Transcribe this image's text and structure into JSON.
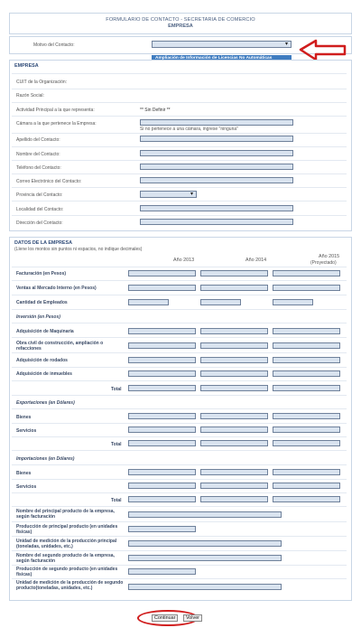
{
  "header": {
    "line1": "FORMULARIO DE CONTACTO - SECRETARIA DE COMERCIO",
    "line2": "EMPRESA"
  },
  "motivo": {
    "label": "Motivo del Contacto:",
    "selected": "",
    "option": "Ampliación de Información de Licencias No Automáticas"
  },
  "empresa": {
    "title": "EMPRESA",
    "cuit": "CUIT de la Organización:",
    "razon": "Razón Social:",
    "actividad": "Actividad Principal a la que representa:",
    "actividad_value": "** Sin Definir **",
    "camara": "Cámara a la que pertenece la Empresa:",
    "camara_hint": "Si no pertenece a una cámara, ingrese \"ninguna\"",
    "apellido": "Apellido del Contacto:",
    "nombre": "Nombre del Contacto:",
    "telefono": "Teléfono del Contacto:",
    "correo": "Correo Electrónico del Contacto:",
    "provincia": "Provincia del Contacto:",
    "localidad": "Localidad del Contacto:",
    "direccion": "Dirección del Contacto:"
  },
  "datos": {
    "title": "DATOS DE LA EMPRESA",
    "subtitle": "(Llene los montos sin puntos ni espacios, no indique decimales)",
    "year1": "Año 2013",
    "year2": "Año 2014",
    "year3": "Año 2015",
    "year3_note": "(Proyectado)",
    "facturacion": "Facturación (en Pesos)",
    "ventas": "Ventas al Mercado Interno (en Pesos)",
    "empleados": "Cantidad de Empleados",
    "inversion_title": "Inversión (en Pesos)",
    "maquinaria": "Adquisición de Maquinaria",
    "obra_civil": "Obra civil de construcción, ampliación o refacciones",
    "rodados": "Adquisición de rodados",
    "inmuebles": "Adquisición de inmuebles",
    "total1": "Total",
    "export_title": "Exportaciones (en Dólares)",
    "bienes1": "Bienes",
    "servicios1": "Servicios",
    "total2": "Total",
    "import_title": "Importaciones (en Dólares)",
    "bienes2": "Bienes",
    "servicios2": "Servicios",
    "total3": "Total",
    "prod1_nombre": "Nombre del principal producto de la empresa, según facturación",
    "prod1_produccion": "Producción de principal producto (en unidades físicas)",
    "prod1_unidad": "Unidad de medición de la producción principal (toneladas, unidades, etc.)",
    "prod2_nombre": "Nombre del segundo producto de la empresa, según facturación",
    "prod2_produccion": "Producción de segundo producto (en unidades físicas)",
    "prod2_unidad": "Unidad de medición de la producción de segundo producto(toneladas, unidades, etc.)"
  },
  "buttons": {
    "continuar": "Continuar",
    "volver": "Volver"
  },
  "colors": {
    "input_fill": "#d9e3ef",
    "accent_red": "#d01d1d",
    "option_blue": "#3f7cc0"
  }
}
